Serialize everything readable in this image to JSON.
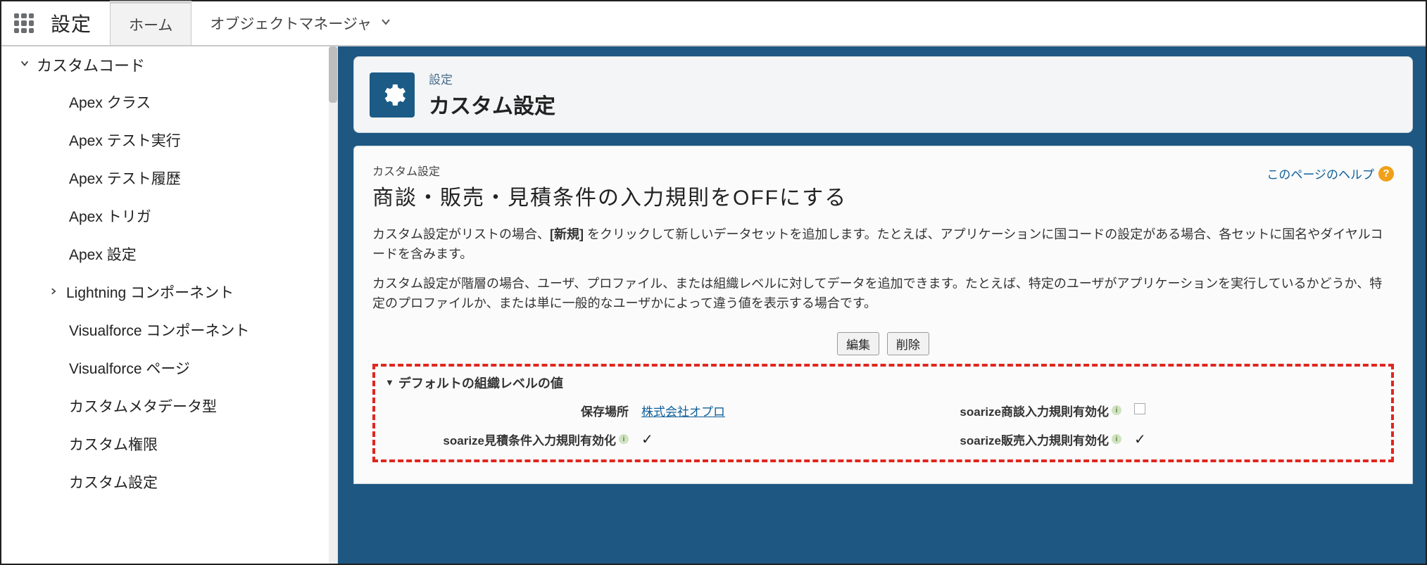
{
  "header": {
    "app_name": "設定",
    "tab_home": "ホーム",
    "tab_object_manager": "オブジェクトマネージャ"
  },
  "sidebar": {
    "parent_label": "カスタムコード",
    "items": [
      "Apex クラス",
      "Apex テスト実行",
      "Apex テスト履歴",
      "Apex トリガ",
      "Apex 設定",
      "Lightning コンポーネント",
      "Visualforce コンポーネント",
      "Visualforce ページ",
      "カスタムメタデータ型",
      "カスタム権限",
      "カスタム設定"
    ]
  },
  "title_card": {
    "sub": "設定",
    "main": "カスタム設定"
  },
  "content": {
    "breadcrumb": "カスタム設定",
    "page_title": "商談・販売・見積条件の入力規則をOFFにする",
    "help_link": "このページのヘルプ",
    "desc1_prefix": "カスタム設定がリストの場合、",
    "desc1_bold": "[新規]",
    "desc1_suffix": " をクリックして新しいデータセットを追加します。たとえば、アプリケーションに国コードの設定がある場合、各セットに国名やダイヤルコードを含みます。",
    "desc2": "カスタム設定が階層の場合、ユーザ、プロファイル、または組織レベルに対してデータを追加できます。たとえば、特定のユーザがアプリケーションを実行しているかどうか、特定のプロファイルか、または単に一般的なユーザかによって違う値を表示する場合です。",
    "btn_edit": "編集",
    "btn_delete": "削除",
    "section_header": "デフォルトの組織レベルの値",
    "fields": {
      "location_label": "保存場所",
      "location_value": "株式会社オプロ",
      "opty_label": "soarize商談入力規則有効化",
      "quote_label": "soarize見積条件入力規則有効化",
      "sales_label": "soarize販売入力規則有効化"
    }
  }
}
